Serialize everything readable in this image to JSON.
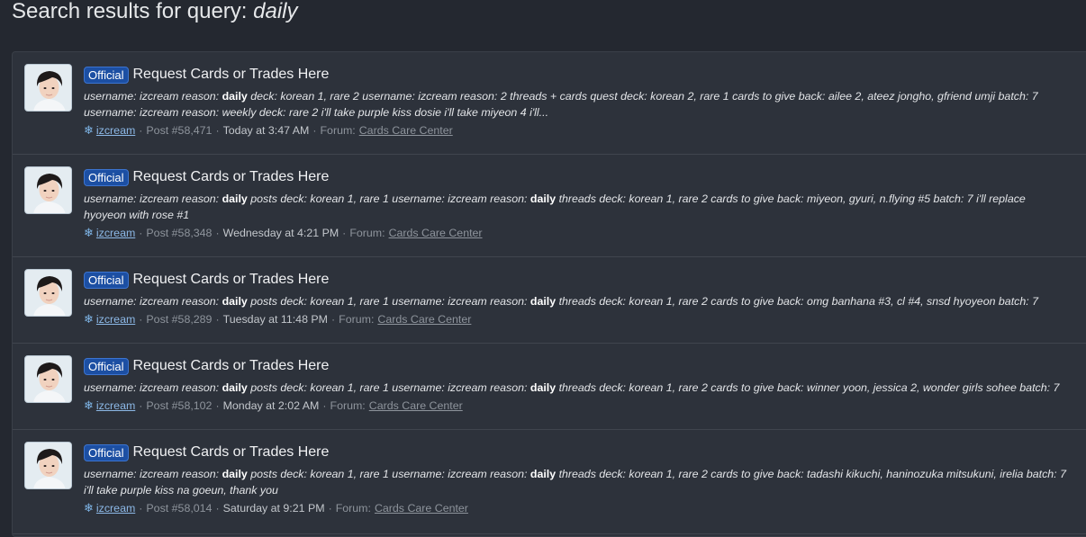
{
  "header": {
    "title_prefix": "Search results for query: ",
    "query": "daily"
  },
  "results": [
    {
      "badge": "Official",
      "title": "Request Cards or Trades Here",
      "snippet": [
        {
          "t": "username: izcream reason: ",
          "b": false
        },
        {
          "t": "daily",
          "b": true
        },
        {
          "t": " deck: korean 1, rare 2 username: izcream reason: 2 threads + cards quest deck: korean 2, rare 1 cards to give back: ailee 2, ateez jongho, gfriend umji batch: 7\nusername: izcream reason: weekly deck: rare 2 i'll take purple kiss dosie i'll take miyeon 4 i'll...",
          "b": false
        }
      ],
      "user": "izcream",
      "post": "Post #58,471",
      "date": "Today at 3:47 AM",
      "forum_label": "Forum:",
      "forum": "Cards Care Center"
    },
    {
      "badge": "Official",
      "title": "Request Cards or Trades Here",
      "snippet": [
        {
          "t": "username: izcream reason: ",
          "b": false
        },
        {
          "t": "daily",
          "b": true
        },
        {
          "t": " posts deck: korean 1, rare 1 username: izcream reason: ",
          "b": false
        },
        {
          "t": "daily",
          "b": true
        },
        {
          "t": " threads deck: korean 1, rare 2 cards to give back: miyeon, gyuri, n.flying #5 batch: 7 i'll replace\nhyoyeon with rose #1",
          "b": false
        }
      ],
      "user": "izcream",
      "post": "Post #58,348",
      "date": "Wednesday at 4:21 PM",
      "forum_label": "Forum:",
      "forum": "Cards Care Center"
    },
    {
      "badge": "Official",
      "title": "Request Cards or Trades Here",
      "snippet": [
        {
          "t": "username: izcream reason: ",
          "b": false
        },
        {
          "t": "daily",
          "b": true
        },
        {
          "t": " posts deck: korean 1, rare 1 username: izcream reason: ",
          "b": false
        },
        {
          "t": "daily",
          "b": true
        },
        {
          "t": " threads deck: korean 1, rare 2 cards to give back: omg banhana #3, cl #4, snsd hyoyeon batch: 7",
          "b": false
        }
      ],
      "user": "izcream",
      "post": "Post #58,289",
      "date": "Tuesday at 11:48 PM",
      "forum_label": "Forum:",
      "forum": "Cards Care Center"
    },
    {
      "badge": "Official",
      "title": "Request Cards or Trades Here",
      "snippet": [
        {
          "t": "username: izcream reason: ",
          "b": false
        },
        {
          "t": "daily",
          "b": true
        },
        {
          "t": " posts deck: korean 1, rare 1 username: izcream reason: ",
          "b": false
        },
        {
          "t": "daily",
          "b": true
        },
        {
          "t": " threads deck: korean 1, rare 2 cards to give back: winner yoon, jessica 2, wonder girls sohee batch: 7",
          "b": false
        }
      ],
      "user": "izcream",
      "post": "Post #58,102",
      "date": "Monday at 2:02 AM",
      "forum_label": "Forum:",
      "forum": "Cards Care Center"
    },
    {
      "badge": "Official",
      "title": "Request Cards or Trades Here",
      "snippet": [
        {
          "t": "username: izcream reason: ",
          "b": false
        },
        {
          "t": "daily",
          "b": true
        },
        {
          "t": " posts deck: korean 1, rare 1 username: izcream reason: ",
          "b": false
        },
        {
          "t": "daily",
          "b": true
        },
        {
          "t": " threads deck: korean 1, rare 2 cards to give back: tadashi kikuchi, haninozuka mitsukuni, irelia batch: 7\ni'll take purple kiss na goeun, thank you",
          "b": false
        }
      ],
      "user": "izcream",
      "post": "Post #58,014",
      "date": "Saturday at 9:21 PM",
      "forum_label": "Forum:",
      "forum": "Cards Care Center"
    }
  ],
  "icons": {
    "user_marker": "snowflake-icon",
    "avatar": "avatar-portrait"
  },
  "colors": {
    "badge_bg": "#1c4fa3",
    "link": "#8cb8e6",
    "background": "#242830"
  }
}
